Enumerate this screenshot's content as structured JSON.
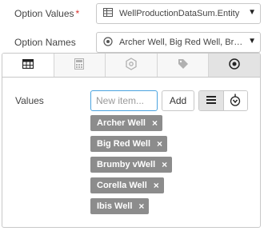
{
  "option_values": {
    "label": "Option Values",
    "required_marker": "*",
    "value": "WellProductionDataSum.Entity"
  },
  "option_names": {
    "label": "Option Names",
    "value": "Archer Well, Big Red Well, Brumby vWell, Corella Well, Ibis Well"
  },
  "tabs": [
    {
      "icon": "table-icon"
    },
    {
      "icon": "calculator-icon"
    },
    {
      "icon": "hexagon-icon"
    },
    {
      "icon": "tag-icon"
    },
    {
      "icon": "target-icon"
    }
  ],
  "values_section": {
    "label": "Values",
    "input_placeholder": "New item...",
    "add_label": "Add",
    "items": [
      {
        "label": "Archer Well"
      },
      {
        "label": "Big Red Well"
      },
      {
        "label": "Brumby vWell"
      },
      {
        "label": "Corella Well"
      },
      {
        "label": "Ibis Well"
      }
    ],
    "remove_glyph": "×"
  },
  "colors": {
    "accent_border": "#4aa3df",
    "chip_bg": "#8c8c8c",
    "required": "#d9302c"
  }
}
